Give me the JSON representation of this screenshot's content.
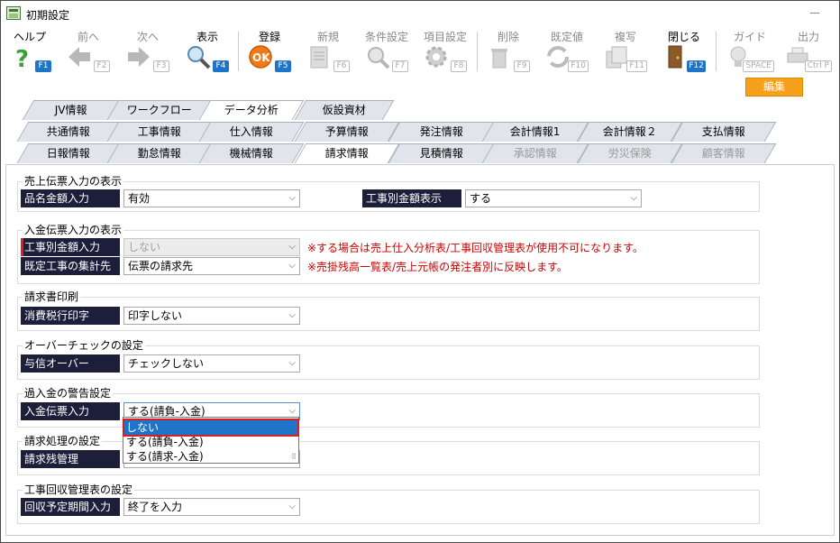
{
  "window": {
    "title": "初期設定"
  },
  "toolbar": {
    "items": [
      {
        "label": "ヘルプ",
        "key": "F1",
        "icon": "help-icon",
        "enabled": true
      },
      {
        "label": "前へ",
        "key": "F2",
        "icon": "arrow-left-icon",
        "enabled": false
      },
      {
        "label": "次へ",
        "key": "F3",
        "icon": "arrow-right-icon",
        "enabled": false
      },
      {
        "label": "表示",
        "key": "F4",
        "icon": "magnifier-icon",
        "enabled": true
      },
      {
        "label": "登録",
        "key": "F5",
        "icon": "ok-icon",
        "enabled": true
      },
      {
        "label": "新規",
        "key": "F6",
        "icon": "new-document-icon",
        "enabled": false
      },
      {
        "label": "条件設定",
        "key": "F7",
        "icon": "search-condition-icon",
        "enabled": false
      },
      {
        "label": "項目設定",
        "key": "F8",
        "icon": "gear-icon",
        "enabled": false
      },
      {
        "label": "削除",
        "key": "F9",
        "icon": "trash-icon",
        "enabled": false
      },
      {
        "label": "既定値",
        "key": "F10",
        "icon": "reset-icon",
        "enabled": false
      },
      {
        "label": "複写",
        "key": "F11",
        "icon": "copy-icon",
        "enabled": false
      },
      {
        "label": "閉じる",
        "key": "F12",
        "icon": "door-icon",
        "enabled": true
      },
      {
        "label": "ガイド",
        "key": "SPACE",
        "icon": "bulb-icon",
        "enabled": false
      },
      {
        "label": "出力",
        "key": "Ctrl P",
        "icon": "printer-icon",
        "enabled": false
      }
    ]
  },
  "edit_label": "編集",
  "tabs": {
    "row1": [
      "JV情報",
      "ワークフロー",
      "データ分析",
      "仮設資材"
    ],
    "row2": [
      "共通情報",
      "工事情報",
      "仕入情報",
      "予算情報",
      "発注情報",
      "会計情報1",
      "会計情報２",
      "支払情報"
    ],
    "row3": [
      "日報情報",
      "勤怠情報",
      "機械情報",
      "請求情報",
      "見積情報",
      "承認情報",
      "労災保険",
      "顧客情報"
    ],
    "active": "請求情報"
  },
  "sections": {
    "sales_slip": {
      "title": "売上伝票入力の表示",
      "item_amount_label": "品名金額入力",
      "item_amount_value": "有効",
      "by_work_label": "工事別金額表示",
      "by_work_value": "する"
    },
    "payment_slip": {
      "title": "入金伝票入力の表示",
      "by_work_label": "工事別金額入力",
      "by_work_value": "しない",
      "by_work_note": "※する場合は売上仕入分析表/工事回収管理表が使用不可になります。",
      "existing_label": "既定工事の集計先",
      "existing_value": "伝票の請求先",
      "existing_note": "※売掛残高一覧表/売上元帳の発注者別に反映します。"
    },
    "invoice_print": {
      "title": "請求書印刷",
      "tax_label": "消費税行印字",
      "tax_value": "印字しない"
    },
    "over_check": {
      "title": "オーバーチェックの設定",
      "credit_label": "与信オーバー",
      "credit_value": "チェックしない"
    },
    "overpayment": {
      "title": "過入金の警告設定",
      "payment_label": "入金伝票入力",
      "payment_value": "する(請負-入金)",
      "options": [
        "しない",
        "する(請負-入金)",
        "する(請求-入金)"
      ]
    },
    "billing": {
      "title": "請求処理の設定",
      "balance_label": "請求残管理"
    },
    "collection": {
      "title": "工事回収管理表の設定",
      "period_label": "回収予定期間入力",
      "period_value": "終了を入力"
    }
  }
}
